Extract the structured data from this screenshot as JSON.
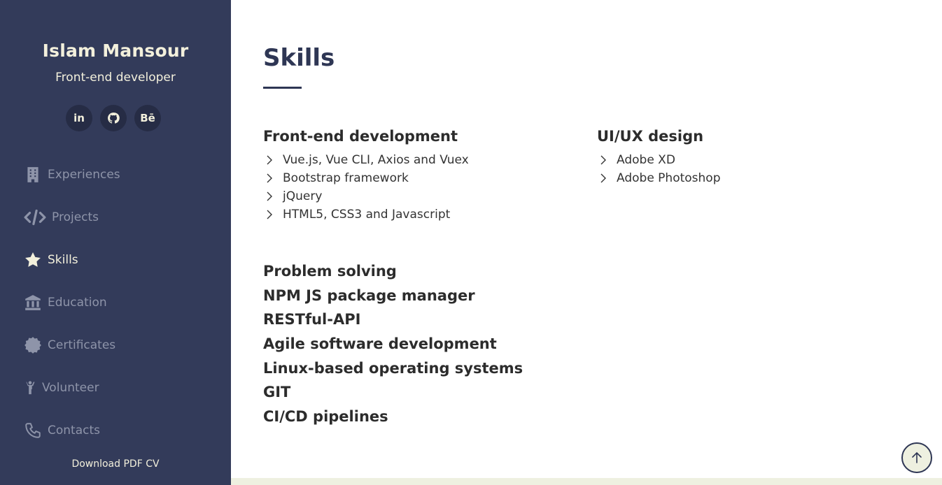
{
  "profile": {
    "name": "Islam Mansour",
    "title": "Front-end developer"
  },
  "socials": [
    {
      "icon": "linkedin-icon",
      "label": "in"
    },
    {
      "icon": "github-icon",
      "label": ""
    },
    {
      "icon": "behance-icon",
      "label": "Bē"
    }
  ],
  "nav": {
    "experiences": "Experiences",
    "projects": "Projects",
    "skills": "Skills",
    "education": "Education",
    "certificates": "Certificates",
    "volunteer": "Volunteer",
    "contacts": "Contacts",
    "download": "Download PDF CV"
  },
  "main": {
    "title": "Skills",
    "frontend": {
      "title": "Front-end development",
      "items": [
        "Vue.js, Vue CLI, Axios and Vuex",
        "Bootstrap framework",
        "jQuery",
        "HTML5, CSS3 and Javascript"
      ]
    },
    "uiux": {
      "title": "UI/UX design",
      "items": [
        "Adobe XD",
        "Adobe Photoshop"
      ]
    },
    "other_skills": [
      "Problem solving",
      "NPM JS package manager",
      "RESTful-API",
      "Agile software development",
      "Linux-based operating systems",
      "GIT",
      "CI/CD pipelines"
    ]
  },
  "colors": {
    "sidebar": "#333b5a",
    "accent": "#2e3654",
    "cream": "#f3f0dc"
  }
}
